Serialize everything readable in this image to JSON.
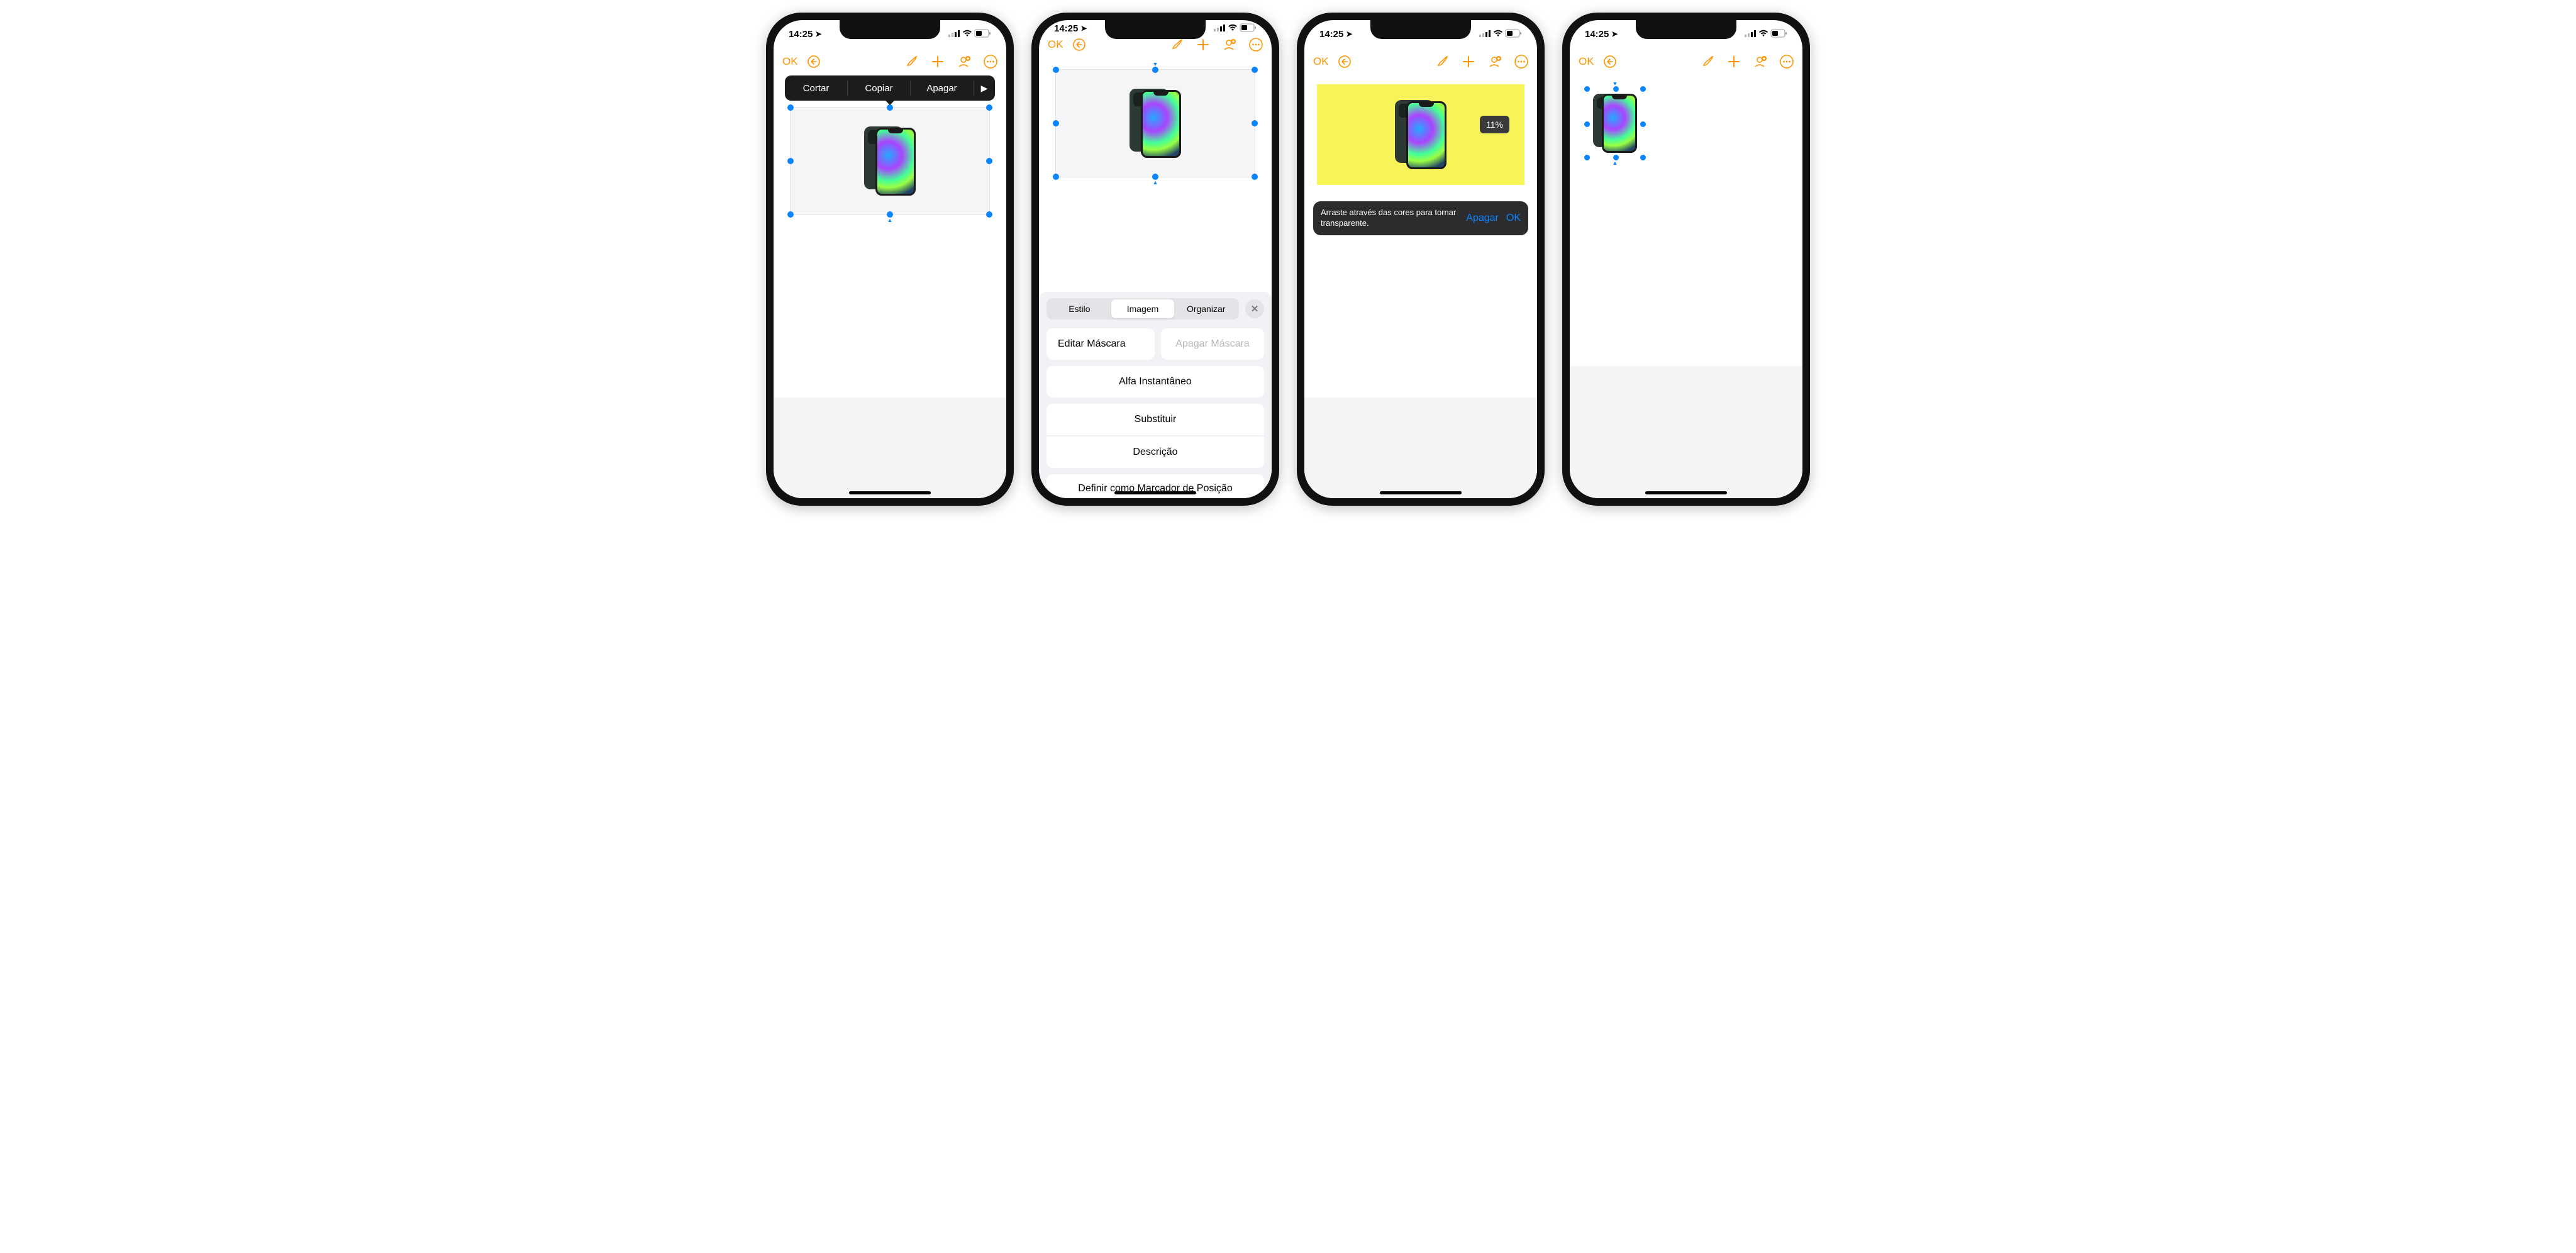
{
  "status": {
    "time": "14:25"
  },
  "toolbar": {
    "ok": "OK"
  },
  "context_menu": {
    "cut": "Cortar",
    "copy": "Copiar",
    "delete": "Apagar",
    "more": "▶"
  },
  "sheet": {
    "tabs": {
      "style": "Estilo",
      "image": "Imagem",
      "arrange": "Organizar"
    },
    "edit_mask": "Editar Máscara",
    "delete_mask": "Apagar Máscara",
    "instant_alpha": "Alfa Instantâneo",
    "replace": "Substituir",
    "description": "Descrição",
    "define_placeholder": "Definir como Marcador de Posição"
  },
  "alpha": {
    "hint": "Arraste através das cores para tornar transparente.",
    "delete": "Apagar",
    "ok": "OK",
    "percent": "11%"
  }
}
